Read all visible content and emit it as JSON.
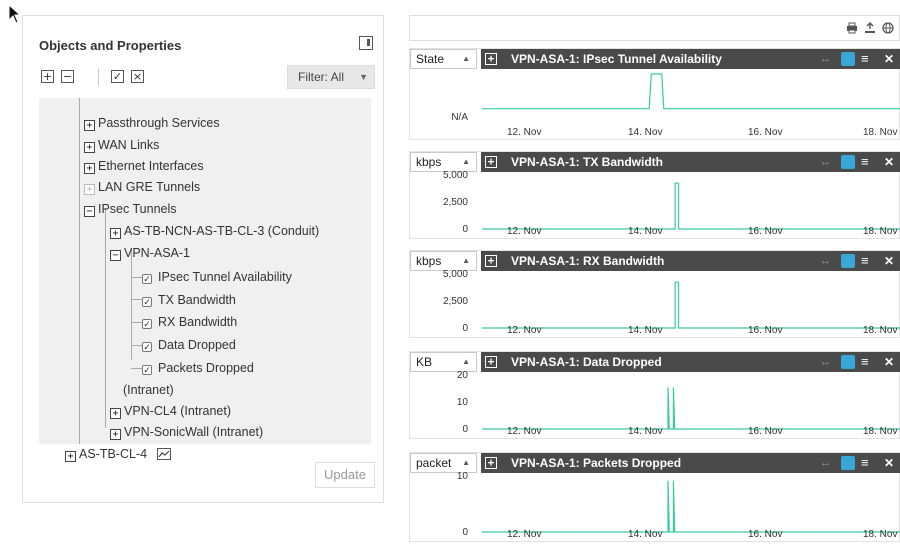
{
  "left_panel": {
    "title": "Objects and Properties",
    "filter_label": "Filter: All",
    "update_label": "Update",
    "tree": [
      {
        "label": "Passthrough Services",
        "kind": "plus"
      },
      {
        "label": "WAN Links",
        "kind": "plus"
      },
      {
        "label": "Ethernet Interfaces",
        "kind": "plus"
      },
      {
        "label": "LAN GRE Tunnels",
        "kind": "plus-dim"
      },
      {
        "label": "IPsec Tunnels",
        "kind": "minus"
      },
      {
        "label": "AS-TB-NCN-AS-TB-CL-3 (Conduit)",
        "kind": "plus"
      },
      {
        "label": "VPN-ASA-1",
        "kind": "minus"
      },
      {
        "label": "IPsec Tunnel Availability",
        "kind": "check"
      },
      {
        "label": "TX Bandwidth",
        "kind": "check"
      },
      {
        "label": "RX Bandwidth",
        "kind": "check"
      },
      {
        "label": "Data Dropped",
        "kind": "check"
      },
      {
        "label": "Packets Dropped",
        "kind": "check"
      },
      {
        "label": "(Intranet)",
        "kind": "text"
      },
      {
        "label": "VPN-CL4 (Intranet)",
        "kind": "plus"
      },
      {
        "label": "VPN-SonicWall (Intranet)",
        "kind": "plus"
      },
      {
        "label": "AS-TB-CL-4",
        "kind": "plus"
      }
    ]
  },
  "charts": [
    {
      "unit": "State",
      "title": "VPN-ASA-1: IPsec Tunnel Availability",
      "yticks": [
        "N/A"
      ],
      "xticks": [
        "12. Nov",
        "14. Nov",
        "16. Nov",
        "18. Nov"
      ]
    },
    {
      "unit": "kbps",
      "title": "VPN-ASA-1: TX Bandwidth",
      "yticks": [
        "5,000",
        "2,500",
        "0"
      ],
      "xticks": [
        "12. Nov",
        "14. Nov",
        "16. Nov",
        "18. Nov"
      ]
    },
    {
      "unit": "kbps",
      "title": "VPN-ASA-1: RX Bandwidth",
      "yticks": [
        "5,000",
        "2,500",
        "0"
      ],
      "xticks": [
        "12. Nov",
        "14. Nov",
        "16. Nov",
        "18. Nov"
      ]
    },
    {
      "unit": "KB",
      "title": "VPN-ASA-1: Data Dropped",
      "yticks": [
        "20",
        "10",
        "0"
      ],
      "xticks": [
        "12. Nov",
        "14. Nov",
        "16. Nov",
        "18. Nov"
      ]
    },
    {
      "unit": "packet",
      "title": "VPN-ASA-1: Packets Dropped",
      "yticks": [
        "10",
        "0"
      ],
      "xticks": [
        "12. Nov",
        "14. Nov",
        "16. Nov",
        "18. Nov"
      ]
    }
  ],
  "colors": {
    "line": "#3cc9a0",
    "header": "#4a4a4a",
    "accent": "#3aa6d8"
  },
  "icons": [
    "print-icon",
    "export-icon",
    "globe-icon",
    "expand-arrows-icon",
    "calendar-icon",
    "menu-icon",
    "close-icon"
  ]
}
